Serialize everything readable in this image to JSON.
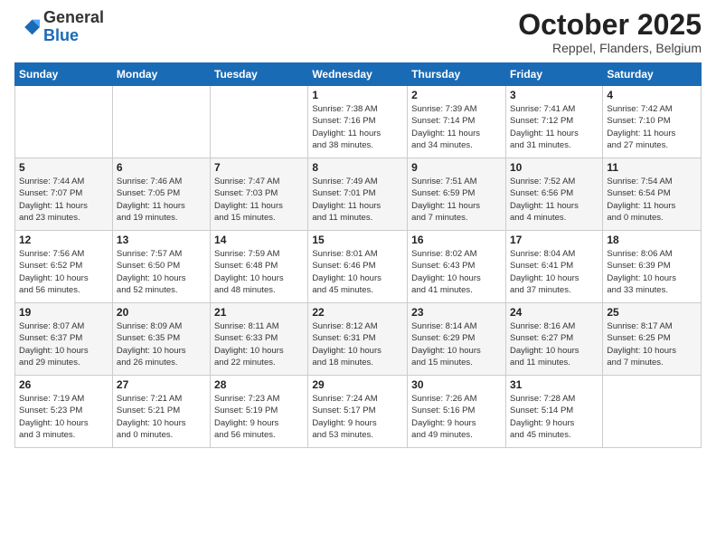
{
  "logo": {
    "general": "General",
    "blue": "Blue"
  },
  "header": {
    "month": "October 2025",
    "location": "Reppel, Flanders, Belgium"
  },
  "days_of_week": [
    "Sunday",
    "Monday",
    "Tuesday",
    "Wednesday",
    "Thursday",
    "Friday",
    "Saturday"
  ],
  "weeks": [
    [
      {
        "day": "",
        "info": ""
      },
      {
        "day": "",
        "info": ""
      },
      {
        "day": "",
        "info": ""
      },
      {
        "day": "1",
        "info": "Sunrise: 7:38 AM\nSunset: 7:16 PM\nDaylight: 11 hours\nand 38 minutes."
      },
      {
        "day": "2",
        "info": "Sunrise: 7:39 AM\nSunset: 7:14 PM\nDaylight: 11 hours\nand 34 minutes."
      },
      {
        "day": "3",
        "info": "Sunrise: 7:41 AM\nSunset: 7:12 PM\nDaylight: 11 hours\nand 31 minutes."
      },
      {
        "day": "4",
        "info": "Sunrise: 7:42 AM\nSunset: 7:10 PM\nDaylight: 11 hours\nand 27 minutes."
      }
    ],
    [
      {
        "day": "5",
        "info": "Sunrise: 7:44 AM\nSunset: 7:07 PM\nDaylight: 11 hours\nand 23 minutes."
      },
      {
        "day": "6",
        "info": "Sunrise: 7:46 AM\nSunset: 7:05 PM\nDaylight: 11 hours\nand 19 minutes."
      },
      {
        "day": "7",
        "info": "Sunrise: 7:47 AM\nSunset: 7:03 PM\nDaylight: 11 hours\nand 15 minutes."
      },
      {
        "day": "8",
        "info": "Sunrise: 7:49 AM\nSunset: 7:01 PM\nDaylight: 11 hours\nand 11 minutes."
      },
      {
        "day": "9",
        "info": "Sunrise: 7:51 AM\nSunset: 6:59 PM\nDaylight: 11 hours\nand 7 minutes."
      },
      {
        "day": "10",
        "info": "Sunrise: 7:52 AM\nSunset: 6:56 PM\nDaylight: 11 hours\nand 4 minutes."
      },
      {
        "day": "11",
        "info": "Sunrise: 7:54 AM\nSunset: 6:54 PM\nDaylight: 11 hours\nand 0 minutes."
      }
    ],
    [
      {
        "day": "12",
        "info": "Sunrise: 7:56 AM\nSunset: 6:52 PM\nDaylight: 10 hours\nand 56 minutes."
      },
      {
        "day": "13",
        "info": "Sunrise: 7:57 AM\nSunset: 6:50 PM\nDaylight: 10 hours\nand 52 minutes."
      },
      {
        "day": "14",
        "info": "Sunrise: 7:59 AM\nSunset: 6:48 PM\nDaylight: 10 hours\nand 48 minutes."
      },
      {
        "day": "15",
        "info": "Sunrise: 8:01 AM\nSunset: 6:46 PM\nDaylight: 10 hours\nand 45 minutes."
      },
      {
        "day": "16",
        "info": "Sunrise: 8:02 AM\nSunset: 6:43 PM\nDaylight: 10 hours\nand 41 minutes."
      },
      {
        "day": "17",
        "info": "Sunrise: 8:04 AM\nSunset: 6:41 PM\nDaylight: 10 hours\nand 37 minutes."
      },
      {
        "day": "18",
        "info": "Sunrise: 8:06 AM\nSunset: 6:39 PM\nDaylight: 10 hours\nand 33 minutes."
      }
    ],
    [
      {
        "day": "19",
        "info": "Sunrise: 8:07 AM\nSunset: 6:37 PM\nDaylight: 10 hours\nand 29 minutes."
      },
      {
        "day": "20",
        "info": "Sunrise: 8:09 AM\nSunset: 6:35 PM\nDaylight: 10 hours\nand 26 minutes."
      },
      {
        "day": "21",
        "info": "Sunrise: 8:11 AM\nSunset: 6:33 PM\nDaylight: 10 hours\nand 22 minutes."
      },
      {
        "day": "22",
        "info": "Sunrise: 8:12 AM\nSunset: 6:31 PM\nDaylight: 10 hours\nand 18 minutes."
      },
      {
        "day": "23",
        "info": "Sunrise: 8:14 AM\nSunset: 6:29 PM\nDaylight: 10 hours\nand 15 minutes."
      },
      {
        "day": "24",
        "info": "Sunrise: 8:16 AM\nSunset: 6:27 PM\nDaylight: 10 hours\nand 11 minutes."
      },
      {
        "day": "25",
        "info": "Sunrise: 8:17 AM\nSunset: 6:25 PM\nDaylight: 10 hours\nand 7 minutes."
      }
    ],
    [
      {
        "day": "26",
        "info": "Sunrise: 7:19 AM\nSunset: 5:23 PM\nDaylight: 10 hours\nand 3 minutes."
      },
      {
        "day": "27",
        "info": "Sunrise: 7:21 AM\nSunset: 5:21 PM\nDaylight: 10 hours\nand 0 minutes."
      },
      {
        "day": "28",
        "info": "Sunrise: 7:23 AM\nSunset: 5:19 PM\nDaylight: 9 hours\nand 56 minutes."
      },
      {
        "day": "29",
        "info": "Sunrise: 7:24 AM\nSunset: 5:17 PM\nDaylight: 9 hours\nand 53 minutes."
      },
      {
        "day": "30",
        "info": "Sunrise: 7:26 AM\nSunset: 5:16 PM\nDaylight: 9 hours\nand 49 minutes."
      },
      {
        "day": "31",
        "info": "Sunrise: 7:28 AM\nSunset: 5:14 PM\nDaylight: 9 hours\nand 45 minutes."
      },
      {
        "day": "",
        "info": ""
      }
    ]
  ]
}
